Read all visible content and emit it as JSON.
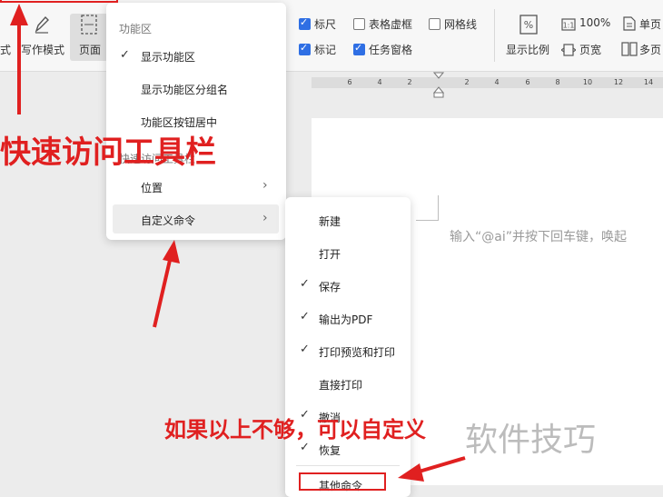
{
  "ribbon": {
    "left_partial_label": "式",
    "writing_mode_label": "写作模式",
    "page_label": "页面",
    "checks": [
      {
        "label": "标尺",
        "checked": true
      },
      {
        "label": "表格虚框",
        "checked": false
      },
      {
        "label": "网格线",
        "checked": false
      },
      {
        "label": "标记",
        "checked": true
      },
      {
        "label": "任务窗格",
        "checked": true
      }
    ],
    "zoom_label": "显示比例",
    "zoom_100_label": "100%",
    "page_width_label": "页宽",
    "single_page_label": "单页",
    "multi_page_label": "多页"
  },
  "ruler": {
    "ticks": [
      "6",
      "4",
      "2",
      "2",
      "4",
      "6",
      "8",
      "10",
      "12",
      "14"
    ]
  },
  "document": {
    "hint": "输入“@ai”并按下回车键，唤起"
  },
  "menu1": {
    "section_functional_area": "功能区",
    "items": [
      {
        "label": "显示功能区",
        "checked": true
      },
      {
        "label": "显示功能区分组名",
        "checked": false
      },
      {
        "label": "功能区按钮居中",
        "checked": false
      }
    ],
    "section_quick_access": "快速访问工具栏",
    "position_label": "位置",
    "custom_command_label": "自定义命令"
  },
  "menu2": {
    "items": [
      {
        "label": "新建",
        "checked": false
      },
      {
        "label": "打开",
        "checked": false
      },
      {
        "label": "保存",
        "checked": true
      },
      {
        "label": "输出为PDF",
        "checked": true
      },
      {
        "label": "打印预览和打印",
        "checked": true
      },
      {
        "label": "直接打印",
        "checked": false
      },
      {
        "label": "撤消",
        "checked": true
      },
      {
        "label": "恢复",
        "checked": true
      }
    ],
    "other_commands_label": "其他命令"
  },
  "annotations": {
    "quick_access_caption": "快速访问工具栏",
    "not_enough_caption": "如果以上不够，可以自定义",
    "watermark": "软件技巧",
    "color": "#e02020"
  }
}
